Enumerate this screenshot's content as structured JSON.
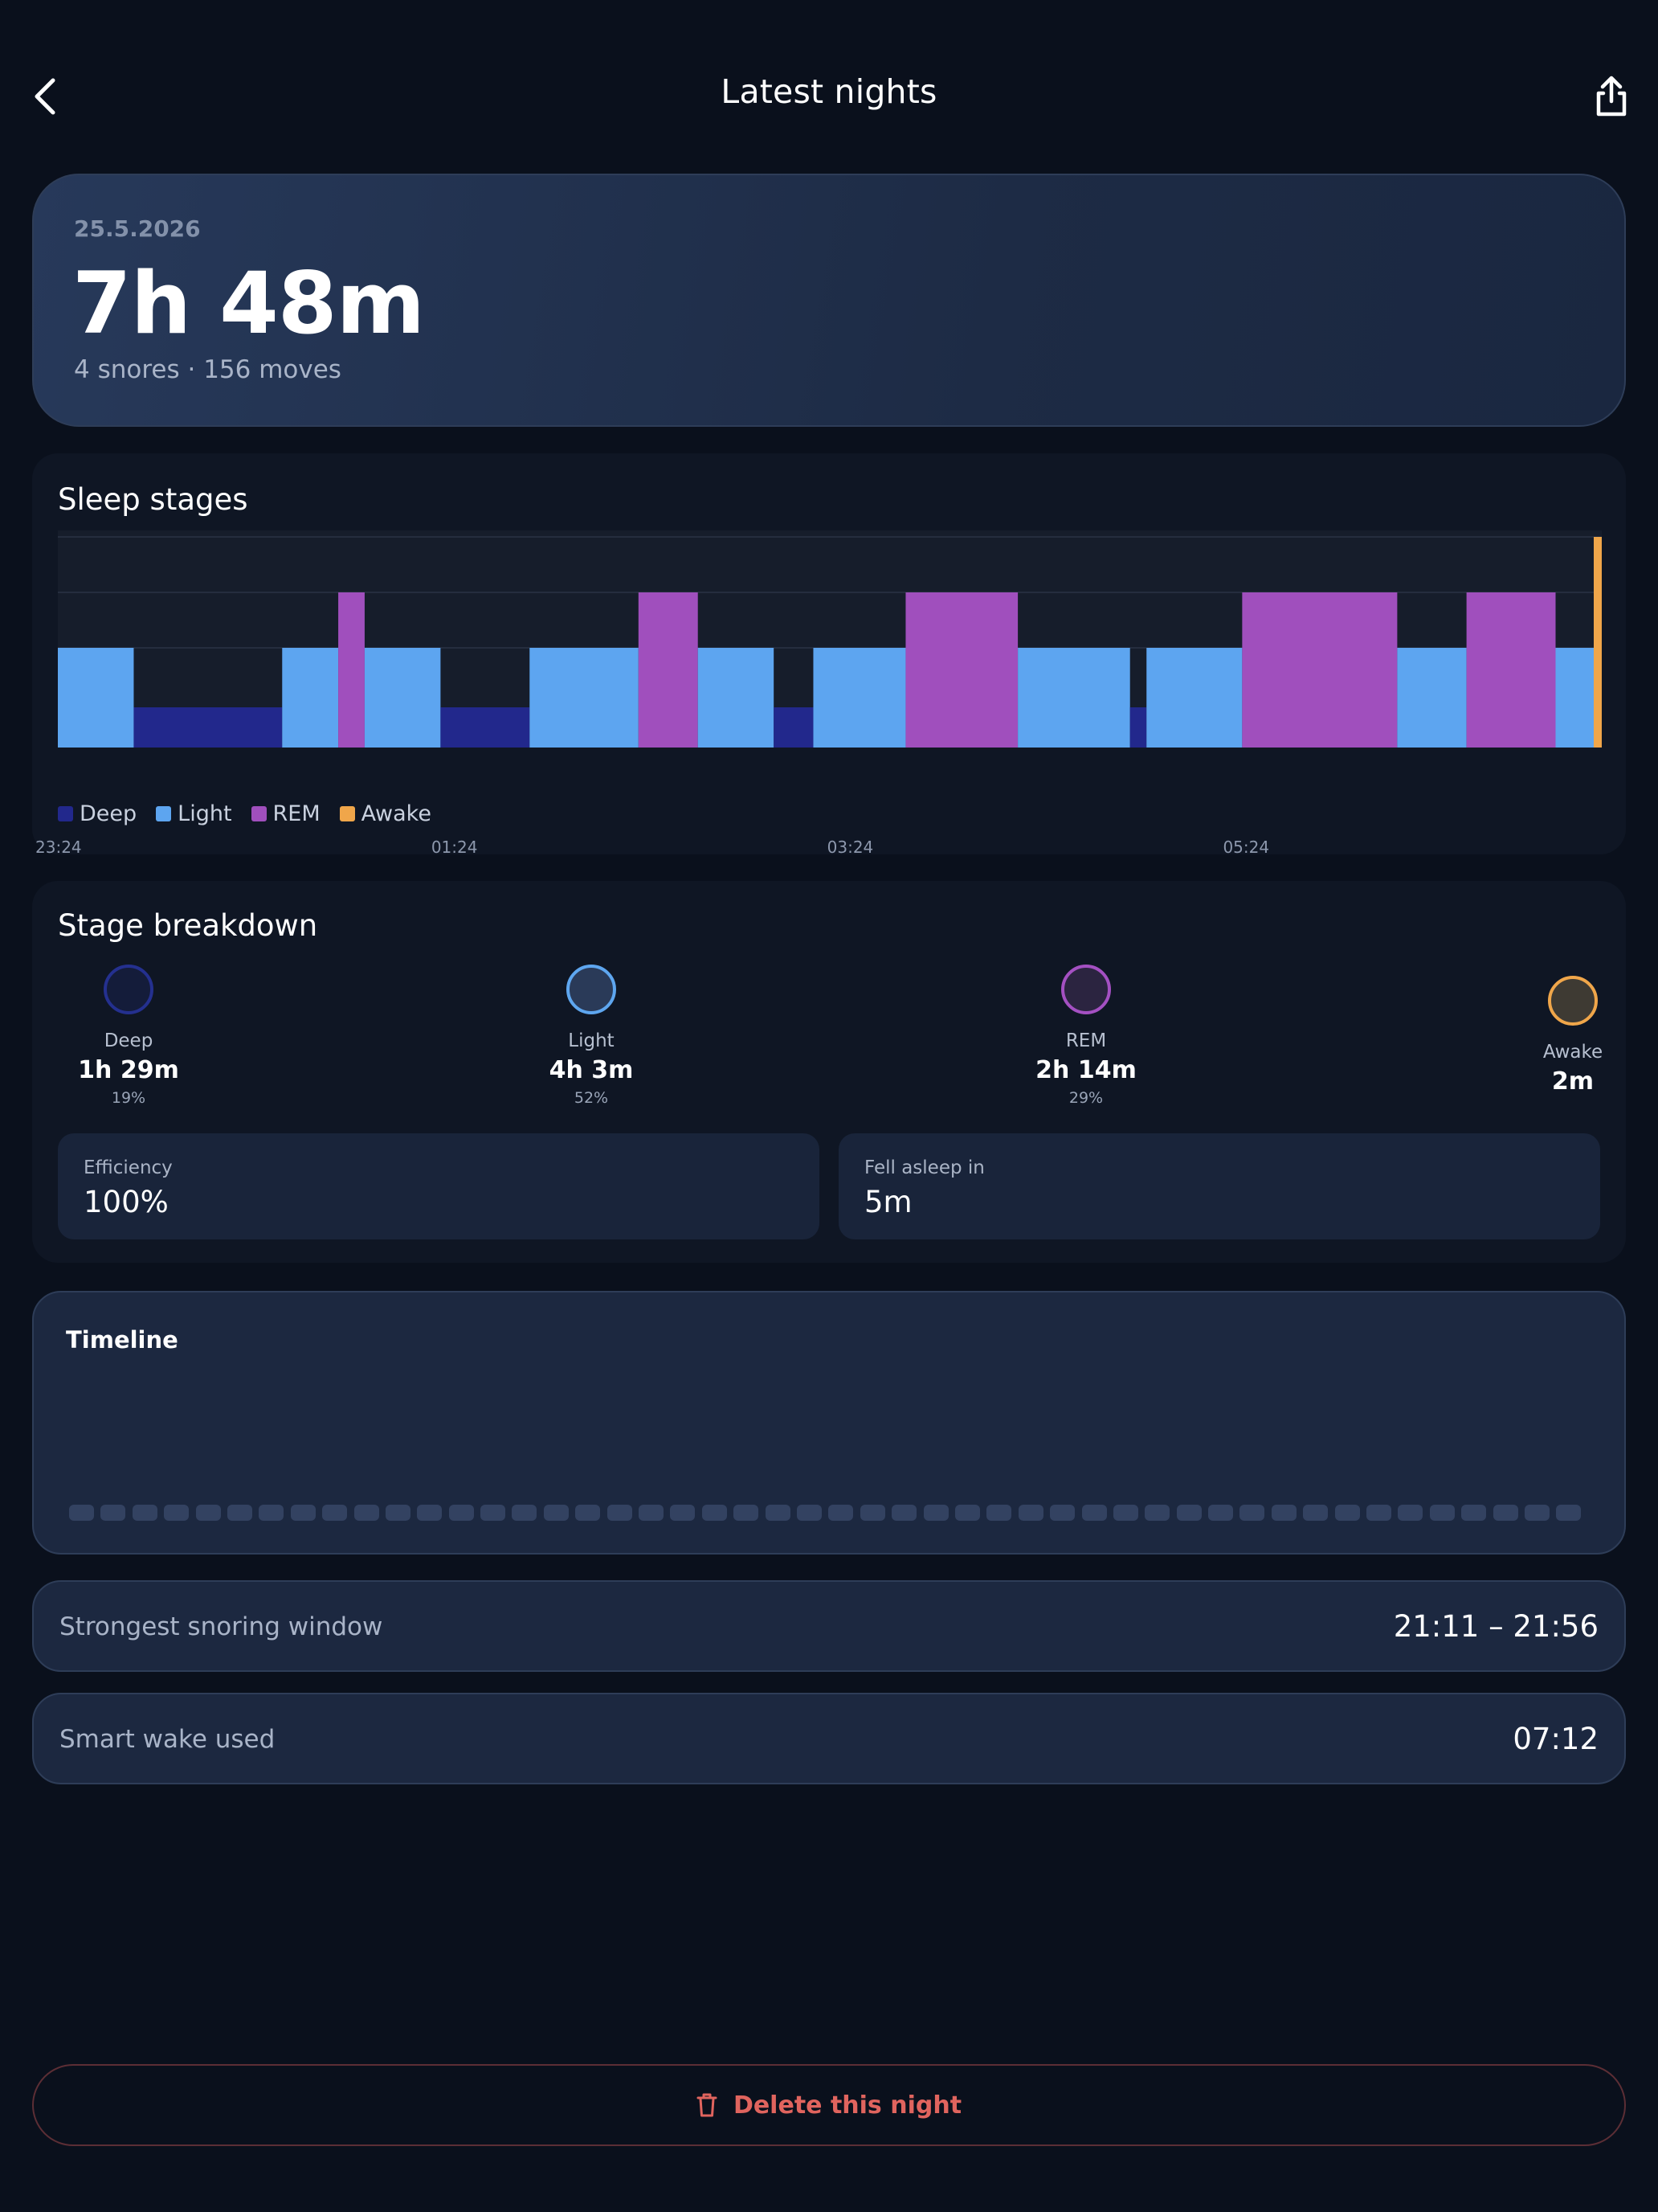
{
  "header": {
    "title": "Latest nights",
    "back_icon": "chevron-left-icon",
    "share_icon": "share-icon"
  },
  "summary": {
    "date": "25.5.2026",
    "duration": "7h 48m",
    "subtitle": "4 snores · 156 moves"
  },
  "sleep_stages": {
    "title": "Sleep stages",
    "legend": [
      {
        "label": "Deep",
        "color": "#22288c"
      },
      {
        "label": "Light",
        "color": "#5da5f0"
      },
      {
        "label": "REM",
        "color": "#a04fbd"
      },
      {
        "label": "Awake",
        "color": "#f0a64a"
      }
    ]
  },
  "chart_data": {
    "type": "area",
    "title": "Sleep stages",
    "x_ticks": [
      "23:24",
      "01:24",
      "03:24",
      "05:24"
    ],
    "stage_levels": [
      "Deep",
      "Light",
      "REM",
      "Awake"
    ],
    "start_time": "23:24",
    "segments": [
      {
        "stage": "Light",
        "from": "23:24",
        "to": "23:47"
      },
      {
        "stage": "Deep",
        "from": "23:47",
        "to": "00:32"
      },
      {
        "stage": "Light",
        "from": "00:32",
        "to": "00:49"
      },
      {
        "stage": "REM",
        "from": "00:49",
        "to": "00:57"
      },
      {
        "stage": "Light",
        "from": "00:57",
        "to": "01:20"
      },
      {
        "stage": "Deep",
        "from": "01:20",
        "to": "01:47"
      },
      {
        "stage": "Light",
        "from": "01:47",
        "to": "02:20"
      },
      {
        "stage": "REM",
        "from": "02:20",
        "to": "02:38"
      },
      {
        "stage": "Light",
        "from": "02:38",
        "to": "03:01"
      },
      {
        "stage": "Deep",
        "from": "03:01",
        "to": "03:13"
      },
      {
        "stage": "Light",
        "from": "03:13",
        "to": "03:41"
      },
      {
        "stage": "REM",
        "from": "03:41",
        "to": "04:15"
      },
      {
        "stage": "Light",
        "from": "04:15",
        "to": "04:49"
      },
      {
        "stage": "Deep",
        "from": "04:49",
        "to": "04:54"
      },
      {
        "stage": "Light",
        "from": "04:54",
        "to": "05:23"
      },
      {
        "stage": "REM",
        "from": "05:23",
        "to": "06:10"
      },
      {
        "stage": "Light",
        "from": "06:10",
        "to": "06:31"
      },
      {
        "stage": "REM",
        "from": "06:31",
        "to": "06:58"
      },
      {
        "stage": "Light",
        "from": "06:58",
        "to": "07:10"
      },
      {
        "stage": "Awake",
        "from": "07:10",
        "to": "07:12"
      }
    ]
  },
  "breakdown": {
    "title": "Stage breakdown",
    "stages": [
      {
        "name": "Deep",
        "duration": "1h 29m",
        "percent": "19%",
        "ring_color": "#24308f",
        "fill": "#141c3a"
      },
      {
        "name": "Light",
        "duration": "4h 3m",
        "percent": "52%",
        "ring_color": "#5ea6ef",
        "fill": "#2a3a58"
      },
      {
        "name": "REM",
        "duration": "2h 14m",
        "percent": "29%",
        "ring_color": "#a450c2",
        "fill": "#2b2440"
      },
      {
        "name": "Awake",
        "duration": "2m",
        "percent": "",
        "ring_color": "#f0a64a",
        "fill": "#3e3a33"
      }
    ],
    "efficiency_label": "Efficiency",
    "efficiency_value": "100%",
    "fell_asleep_label": "Fell asleep in",
    "fell_asleep_value": "5m"
  },
  "timeline": {
    "title": "Timeline",
    "bar_count": 48
  },
  "snoring_window": {
    "label": "Strongest snoring window",
    "value": "21:11 – 21:56"
  },
  "smart_wake": {
    "label": "Smart wake used",
    "value": "07:12"
  },
  "delete_button": {
    "label": "Delete this night",
    "icon": "trash-icon"
  }
}
